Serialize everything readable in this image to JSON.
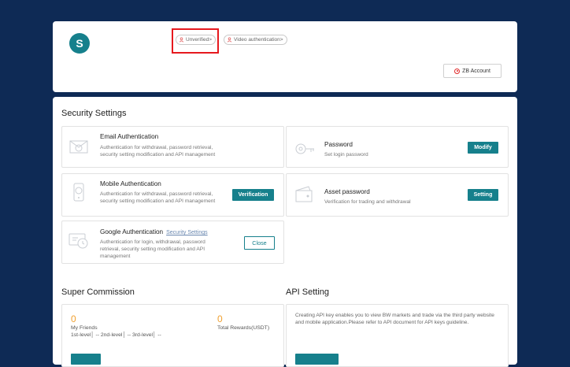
{
  "profile": {
    "avatar_letter": "S",
    "unverified_label": "Unverified>",
    "video_label": "Video authentication>",
    "zb_account_label": "ZB Account"
  },
  "security": {
    "title": "Security Settings",
    "email": {
      "title": "Email Authentication",
      "desc": "Authentication for withdrawal, password retrieval, security setting modification and API management"
    },
    "password": {
      "title": "Password",
      "desc": "Set login password",
      "button": "Modify"
    },
    "mobile": {
      "title": "Mobile Authentication",
      "desc": "Authentication for withdrawal, password retrieval, security setting modification and API management",
      "button": "Verification"
    },
    "asset": {
      "title": "Asset password",
      "desc": "Verification for trading and withdrawal",
      "button": "Setting"
    },
    "google": {
      "title": "Google Authentication",
      "link": "Security Settings",
      "desc": "Authentication for login, withdrawal, password retrieval, security setting modification and API management",
      "button": "Close"
    }
  },
  "commission": {
    "title": "Super Commission",
    "friends_value": "0",
    "friends_label": "My Friends",
    "levels": "1st-level│ --  2nd-level│ --  3rd-level│ --",
    "rewards_value": "0",
    "rewards_label": "Total Rewards(USDT)"
  },
  "api": {
    "title": "API Setting",
    "desc": "Creating API key enables you to view BW markets and trade via the third party website and mobile application.Please refer to API document for API keys guideline."
  },
  "colors": {
    "accent": "#16808c",
    "background": "#0e2a55",
    "highlight": "#e6191e"
  }
}
